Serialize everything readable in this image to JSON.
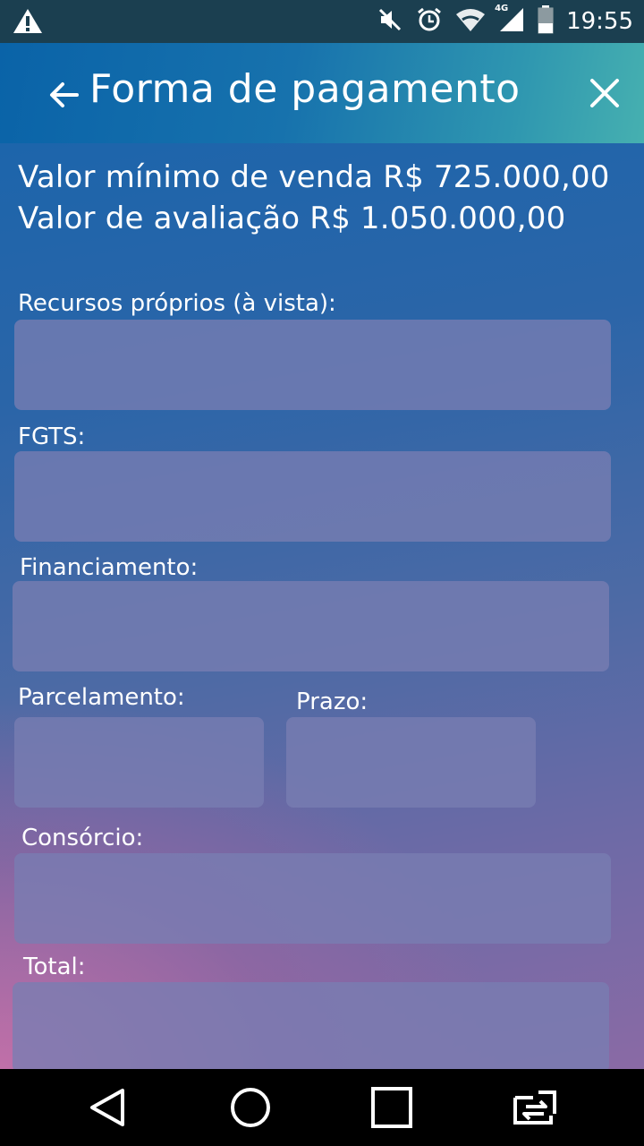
{
  "status_bar": {
    "time": "19:55",
    "network_label": "4G",
    "icons": [
      "warning-icon",
      "mute-icon",
      "alarm-icon",
      "wifi-icon",
      "signal-icon",
      "battery-icon"
    ]
  },
  "app_bar": {
    "title": "Forma de pagamento",
    "back_icon": "arrow-left-icon",
    "close_icon": "close-icon"
  },
  "info": {
    "min_sale_value": "Valor mínimo de venda R$ 725.000,00",
    "appraisal_value": "Valor de avaliação R$ 1.050.000,00"
  },
  "form": {
    "own_resources_label": "Recursos próprios (à vista):",
    "own_resources_value": "",
    "fgts_label": "FGTS:",
    "fgts_value": "",
    "financing_label": "Financiamento:",
    "financing_value": "",
    "installment_label": "Parcelamento:",
    "installment_value": "",
    "term_label": "Prazo:",
    "term_value": "",
    "consortium_label": "Consórcio:",
    "consortium_value": "",
    "total_label": "Total:",
    "total_value": ""
  },
  "nav_bar": {
    "icons": [
      "back-triangle-icon",
      "home-circle-icon",
      "recents-square-icon",
      "switch-apps-icon"
    ]
  }
}
